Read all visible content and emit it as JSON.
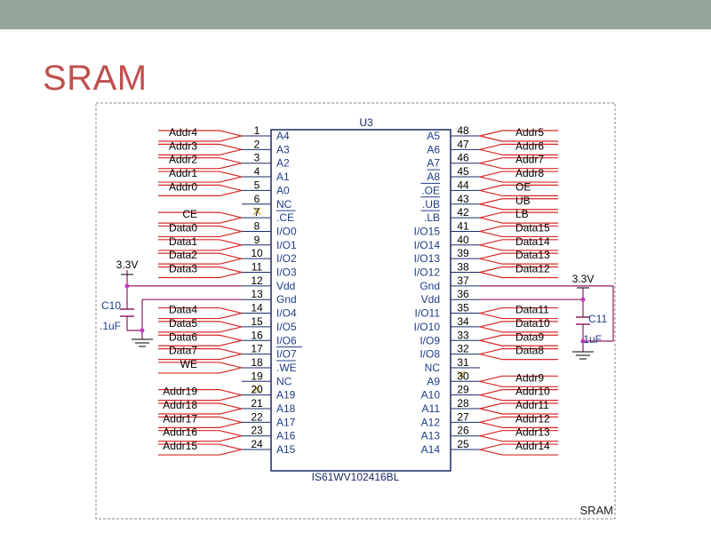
{
  "slide": {
    "title": "SRAM"
  },
  "schematic": {
    "chip_ref": "U3",
    "chip_part": "IS61WV102416BL",
    "sheet_label": "SRAM",
    "left_pins": [
      {
        "num": "1",
        "name": "A4",
        "net": "Addr4"
      },
      {
        "num": "2",
        "name": "A3",
        "net": "Addr3"
      },
      {
        "num": "3",
        "name": "A2",
        "net": "Addr2"
      },
      {
        "num": "4",
        "name": "A1",
        "net": "Addr1"
      },
      {
        "num": "5",
        "name": "A0",
        "net": "Addr0"
      },
      {
        "num": "6",
        "name": "NC",
        "net": ""
      },
      {
        "num": "7",
        "name": ".CE",
        "net": "CE"
      },
      {
        "num": "8",
        "name": "I/O0",
        "net": "Data0"
      },
      {
        "num": "9",
        "name": "I/O1",
        "net": "Data1"
      },
      {
        "num": "10",
        "name": "I/O2",
        "net": "Data2"
      },
      {
        "num": "11",
        "name": "I/O3",
        "net": "Data3"
      },
      {
        "num": "12",
        "name": "Vdd",
        "net": ""
      },
      {
        "num": "13",
        "name": "Gnd",
        "net": ""
      },
      {
        "num": "14",
        "name": "I/O4",
        "net": "Data4"
      },
      {
        "num": "15",
        "name": "I/O5",
        "net": "Data5"
      },
      {
        "num": "16",
        "name": "I/O6",
        "net": "Data6"
      },
      {
        "num": "17",
        "name": "I/O7",
        "net": "Data7"
      },
      {
        "num": "18",
        "name": ".WE",
        "net": "WE"
      },
      {
        "num": "19",
        "name": "NC",
        "net": ""
      },
      {
        "num": "20",
        "name": "A19",
        "net": "Addr19"
      },
      {
        "num": "21",
        "name": "A18",
        "net": "Addr18"
      },
      {
        "num": "22",
        "name": "A17",
        "net": "Addr17"
      },
      {
        "num": "23",
        "name": "A16",
        "net": "Addr16"
      },
      {
        "num": "24",
        "name": "A15",
        "net": "Addr15"
      }
    ],
    "right_pins": [
      {
        "num": "48",
        "name": "A5",
        "net": "Addr5"
      },
      {
        "num": "47",
        "name": "A6",
        "net": "Addr6"
      },
      {
        "num": "46",
        "name": "A7",
        "net": "Addr7"
      },
      {
        "num": "45",
        "name": "A8",
        "net": "Addr8"
      },
      {
        "num": "44",
        "name": ".OE",
        "net": "OE"
      },
      {
        "num": "43",
        "name": ".UB",
        "net": "UB"
      },
      {
        "num": "42",
        "name": ".LB",
        "net": "LB"
      },
      {
        "num": "41",
        "name": "I/O15",
        "net": "Data15"
      },
      {
        "num": "40",
        "name": "I/O14",
        "net": "Data14"
      },
      {
        "num": "39",
        "name": "I/O13",
        "net": "Data13"
      },
      {
        "num": "38",
        "name": "I/O12",
        "net": "Data12"
      },
      {
        "num": "37",
        "name": "Gnd",
        "net": ""
      },
      {
        "num": "36",
        "name": "Vdd",
        "net": ""
      },
      {
        "num": "35",
        "name": "I/O11",
        "net": "Data11"
      },
      {
        "num": "34",
        "name": "I/O10",
        "net": "Data10"
      },
      {
        "num": "33",
        "name": "I/O9",
        "net": "Data9"
      },
      {
        "num": "32",
        "name": "I/O8",
        "net": "Data8"
      },
      {
        "num": "31",
        "name": "NC",
        "net": ""
      },
      {
        "num": "30",
        "name": "A9",
        "net": "Addr9"
      },
      {
        "num": "29",
        "name": "A10",
        "net": "Addr10"
      },
      {
        "num": "28",
        "name": "A11",
        "net": "Addr11"
      },
      {
        "num": "27",
        "name": "A12",
        "net": "Addr12"
      },
      {
        "num": "26",
        "name": "A13",
        "net": "Addr13"
      },
      {
        "num": "25",
        "name": "A14",
        "net": "Addr14"
      }
    ],
    "left_cap": {
      "ref": "C10",
      "value": ".1uF",
      "supply": "3.3V"
    },
    "right_cap": {
      "ref": "C11",
      "value": ".1uF",
      "supply": "3.3V"
    },
    "colors": {
      "wire": "#d62828",
      "chip": "#1a2a66",
      "pin_name": "#1f3c88",
      "power": "#8c1d5a",
      "node": "#cc33cc",
      "text": "#000000"
    }
  }
}
